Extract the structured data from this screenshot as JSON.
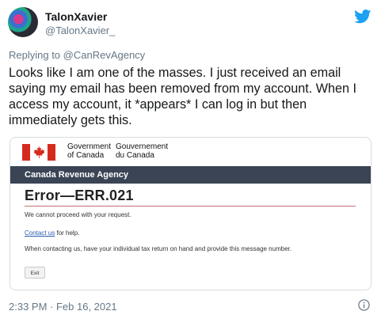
{
  "author": {
    "display_name": "TalonXavier",
    "handle": "@TalonXavier_"
  },
  "tweet": {
    "replying_prefix": "Replying to ",
    "replying_to": "@CanRevAgency",
    "text": "Looks like I am one of the masses.  I just received an email saying my email has been removed from my account. When I access my account, it *appears* I can log in but then immediately gets this.",
    "timestamp": "2:33 PM · Feb 16, 2021"
  },
  "embedded_screenshot": {
    "gov_en_line1": "Government",
    "gov_en_line2": "of Canada",
    "gov_fr_line1": "Gouvernement",
    "gov_fr_line2": "du Canada",
    "agency": "Canada Revenue Agency",
    "error_title": "Error—ERR.021",
    "message_1": "We cannot proceed with your request.",
    "contact_link": "Contact us",
    "contact_suffix": " for help.",
    "message_3": "When contacting us, have your individual tax return on hand and provide this message number.",
    "exit_button": "Exit"
  },
  "icons": {
    "brand": "twitter-bird-icon",
    "info": "info-icon",
    "flag": "canada-flag-icon"
  },
  "colors": {
    "twitter_blue": "#1da1f2",
    "agency_bar": "#3a4454",
    "flag_red": "#d52b1e",
    "muted_text": "#657786"
  }
}
